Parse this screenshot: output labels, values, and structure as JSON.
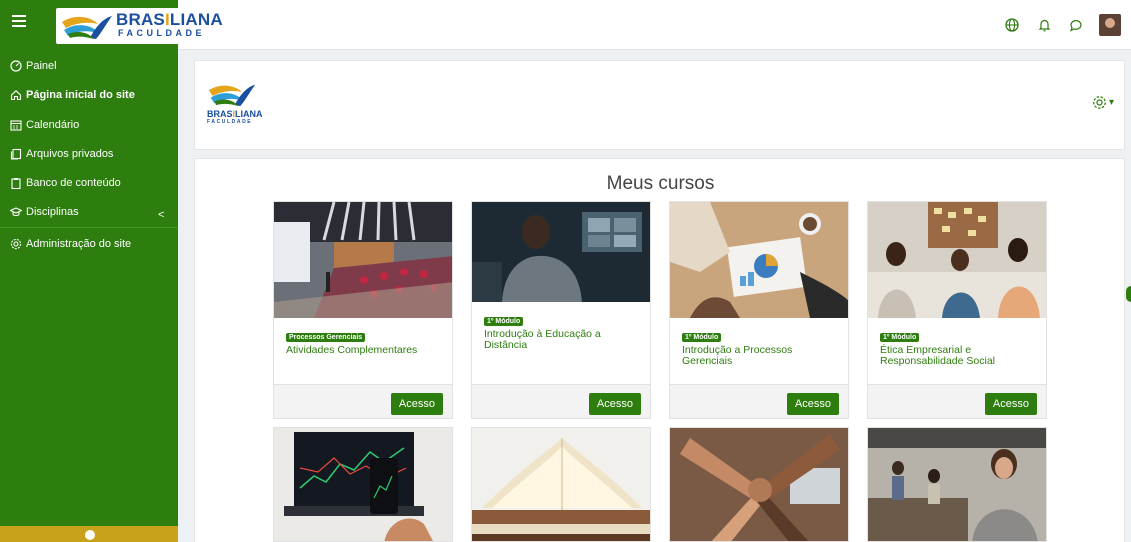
{
  "brand": {
    "name_a": "BRAS",
    "name_b": "I",
    "name_c": "LIANA",
    "subtitle": "FACULDADE"
  },
  "navbar": {
    "menu_icon": "hamburger-icon",
    "icons": [
      "globe-icon",
      "bell-icon",
      "chat-icon",
      "user-avatar"
    ]
  },
  "sidebar": {
    "items": [
      {
        "label": "Painel",
        "icon": "dashboard-icon"
      },
      {
        "label": "Página inicial do site",
        "icon": "home-icon"
      },
      {
        "label": "Calendário",
        "icon": "calendar-icon"
      },
      {
        "label": "Arquivos privados",
        "icon": "files-icon"
      },
      {
        "label": "Banco de conteúdo",
        "icon": "clipboard-icon"
      },
      {
        "label": "Disciplinas",
        "icon": "graduation-cap-icon",
        "chevron": "<"
      },
      {
        "label": "Administração do site",
        "icon": "gear-icon"
      }
    ]
  },
  "header": {
    "settings_icon": "gear-icon",
    "settings_caret": "▾"
  },
  "main": {
    "title": "Meus cursos",
    "courses": [
      {
        "badge": "Processos Gerenciais",
        "title": "Atividades Complementares",
        "button": "Acesso"
      },
      {
        "badge": "1º Módulo",
        "title": "Introdução à Educação a Distância",
        "button": "Acesso"
      },
      {
        "badge": "1º Módulo",
        "title": "Introdução a Processos Gerenciais",
        "button": "Acesso"
      },
      {
        "badge": "1º Módulo",
        "title": "Ética Empresarial e Responsabilidade Social",
        "button": "Acesso"
      }
    ]
  },
  "colors": {
    "brand_green": "#2e7d0f",
    "brand_blue": "#1b4fa0",
    "brand_gold": "#e4a51a",
    "sidebar_bottom": "#c9a21b"
  }
}
